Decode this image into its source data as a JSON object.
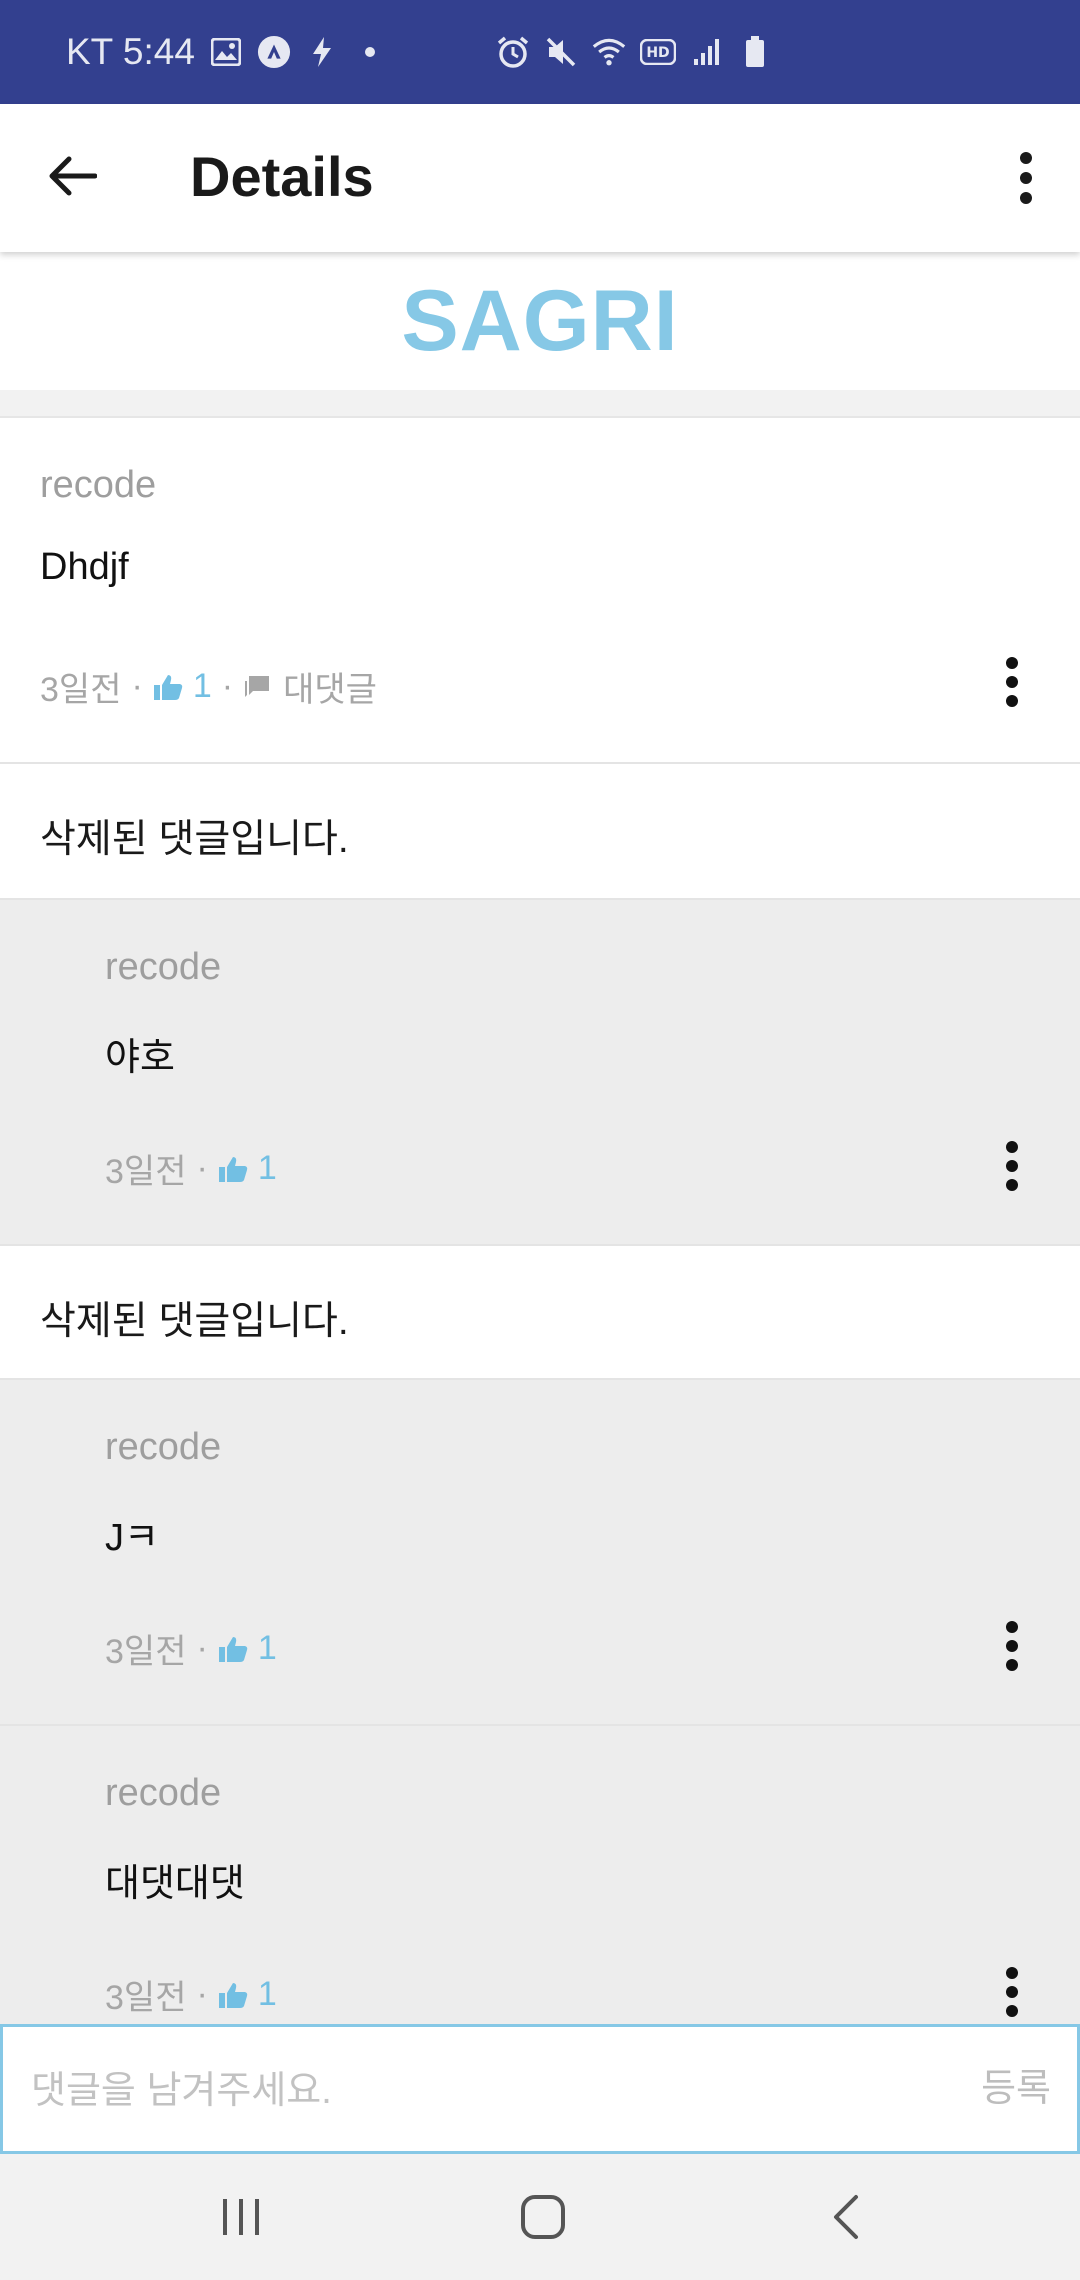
{
  "status_bar": {
    "carrier_time": "KT 5:44",
    "icons": [
      "image-icon",
      "app-notification-icon",
      "bolt-icon",
      "dot-icon",
      "alarm-icon",
      "mute-icon",
      "wifi-icon",
      "hd-icon",
      "signal-icon",
      "battery-icon"
    ],
    "hd_label": "HD"
  },
  "app_bar": {
    "title": "Details",
    "back_icon": "arrow-left-icon",
    "overflow_icon": "more-vert-icon"
  },
  "brand": {
    "text": "SAGRI",
    "color": "#86c8e6"
  },
  "comments": [
    {
      "kind": "comment",
      "author": "recode",
      "body": "Dhdjf",
      "time": "3일전",
      "likes": "1",
      "reply_label": "대댓글",
      "sep": "·"
    },
    {
      "kind": "deleted",
      "text": "삭제된 댓글입니다."
    },
    {
      "kind": "reply",
      "author": "recode",
      "body": "야호",
      "time": "3일전",
      "likes": "1",
      "sep": "·"
    },
    {
      "kind": "deleted",
      "text": "삭제된 댓글입니다."
    },
    {
      "kind": "reply",
      "author": "recode",
      "body": "Jㅋ",
      "time": "3일전",
      "likes": "1",
      "sep": "·"
    },
    {
      "kind": "reply",
      "author": "recode",
      "body": "대댓대댓",
      "time": "3일전",
      "likes": "1",
      "sep": "·"
    }
  ],
  "input": {
    "placeholder": "댓글을 남겨주세요.",
    "value": "",
    "submit_label": "등록"
  },
  "colors": {
    "status_bar": "#33408f",
    "accent": "#86c8e6",
    "like": "#72bfe3",
    "reply_bg": "#ededed"
  }
}
